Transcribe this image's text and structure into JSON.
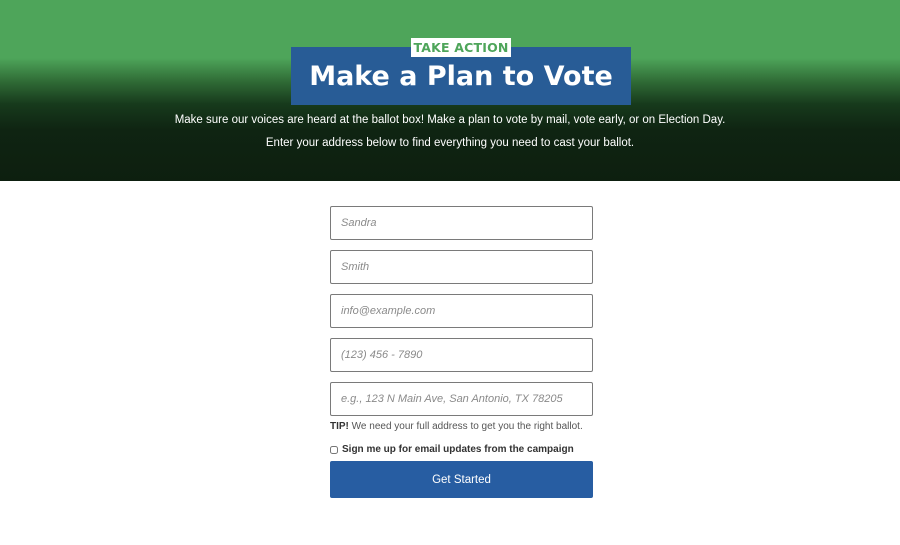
{
  "hero": {
    "eyebrow": "TAKE ACTION",
    "title": "Make a Plan to Vote",
    "intro_line_1": "Make sure our voices are heard at the ballot box! Make a plan to vote by mail, vote early, or on Election Day.",
    "intro_line_2": "Enter your address below to find everything you need to cast your ballot.",
    "colors": {
      "green": "#4ea55a",
      "title_bg": "#285c96",
      "dark": "#0d1f0f"
    }
  },
  "form": {
    "first_name": {
      "value": "",
      "placeholder": "Sandra"
    },
    "last_name": {
      "value": "",
      "placeholder": "Smith"
    },
    "email": {
      "value": "",
      "placeholder": "info@example.com"
    },
    "phone": {
      "value": "",
      "placeholder": "(123) 456 - 7890"
    },
    "address": {
      "value": "",
      "placeholder": "e.g., 123 N Main Ave, San Antonio, TX 78205"
    },
    "tip_label": "TIP!",
    "tip_text": " We need your full address to get you the right ballot.",
    "optin_label": "Sign me up for email updates from the campaign",
    "optin_checked": false,
    "submit_label": "Get Started",
    "submit_color": "#275da2"
  }
}
